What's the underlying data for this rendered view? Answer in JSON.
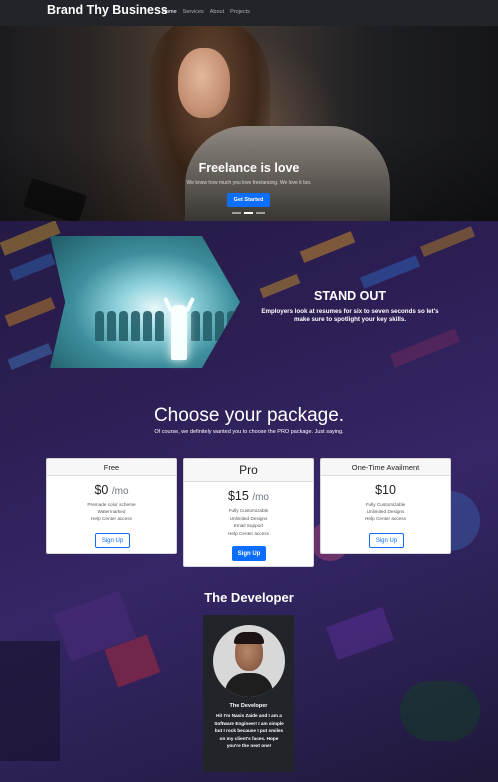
{
  "navbar": {
    "brand": "Brand Thy Business",
    "links": [
      {
        "label": "Home",
        "active": true
      },
      {
        "label": "Services",
        "active": false
      },
      {
        "label": "About",
        "active": false
      },
      {
        "label": "Projects",
        "active": false
      }
    ]
  },
  "hero": {
    "title": "Freelance is love",
    "subtitle": "We know how much you love freelancing. We love it too.",
    "cta_label": "Get Started",
    "active_slide": 2,
    "slide_count": 3
  },
  "feature": {
    "title": "STAND OUT",
    "text": "Employers look at resumes for six to seven seconds so let's make sure to spotlight your key skills."
  },
  "packages": {
    "title": "Choose your package.",
    "subtitle": "Of course, we definitely wanted you to choose the PRO package. Just saying.",
    "cards": [
      {
        "name": "Free",
        "price": "$0",
        "period": "/mo",
        "features": [
          "Premade color scheme",
          "Watermarked",
          "Help Center access"
        ],
        "button": "Sign Up"
      },
      {
        "name": "Pro",
        "price": "$15",
        "period": "/mo",
        "features": [
          "Fully Customizable",
          "Unlimited Designs",
          "Email Support",
          "Help Center access"
        ],
        "button": "Sign Up"
      },
      {
        "name": "One-Time Availment",
        "price": "$10",
        "period": "",
        "features": [
          "Fully Customizable",
          "Unlimited Designs",
          "Help Center access"
        ],
        "button": "Sign Up"
      }
    ]
  },
  "developer": {
    "section_title": "The Developer",
    "card_title": "The Developer",
    "bio": "Hi! I'm Nasis Zaide and I am a Software Engineer! I am simple but I rock because I put smiles on my client's faces. Hope you're the next one!"
  },
  "colors": {
    "navbar_bg": "#212529",
    "primary": "#0d6efd",
    "page_bg": "#2d1f55"
  }
}
